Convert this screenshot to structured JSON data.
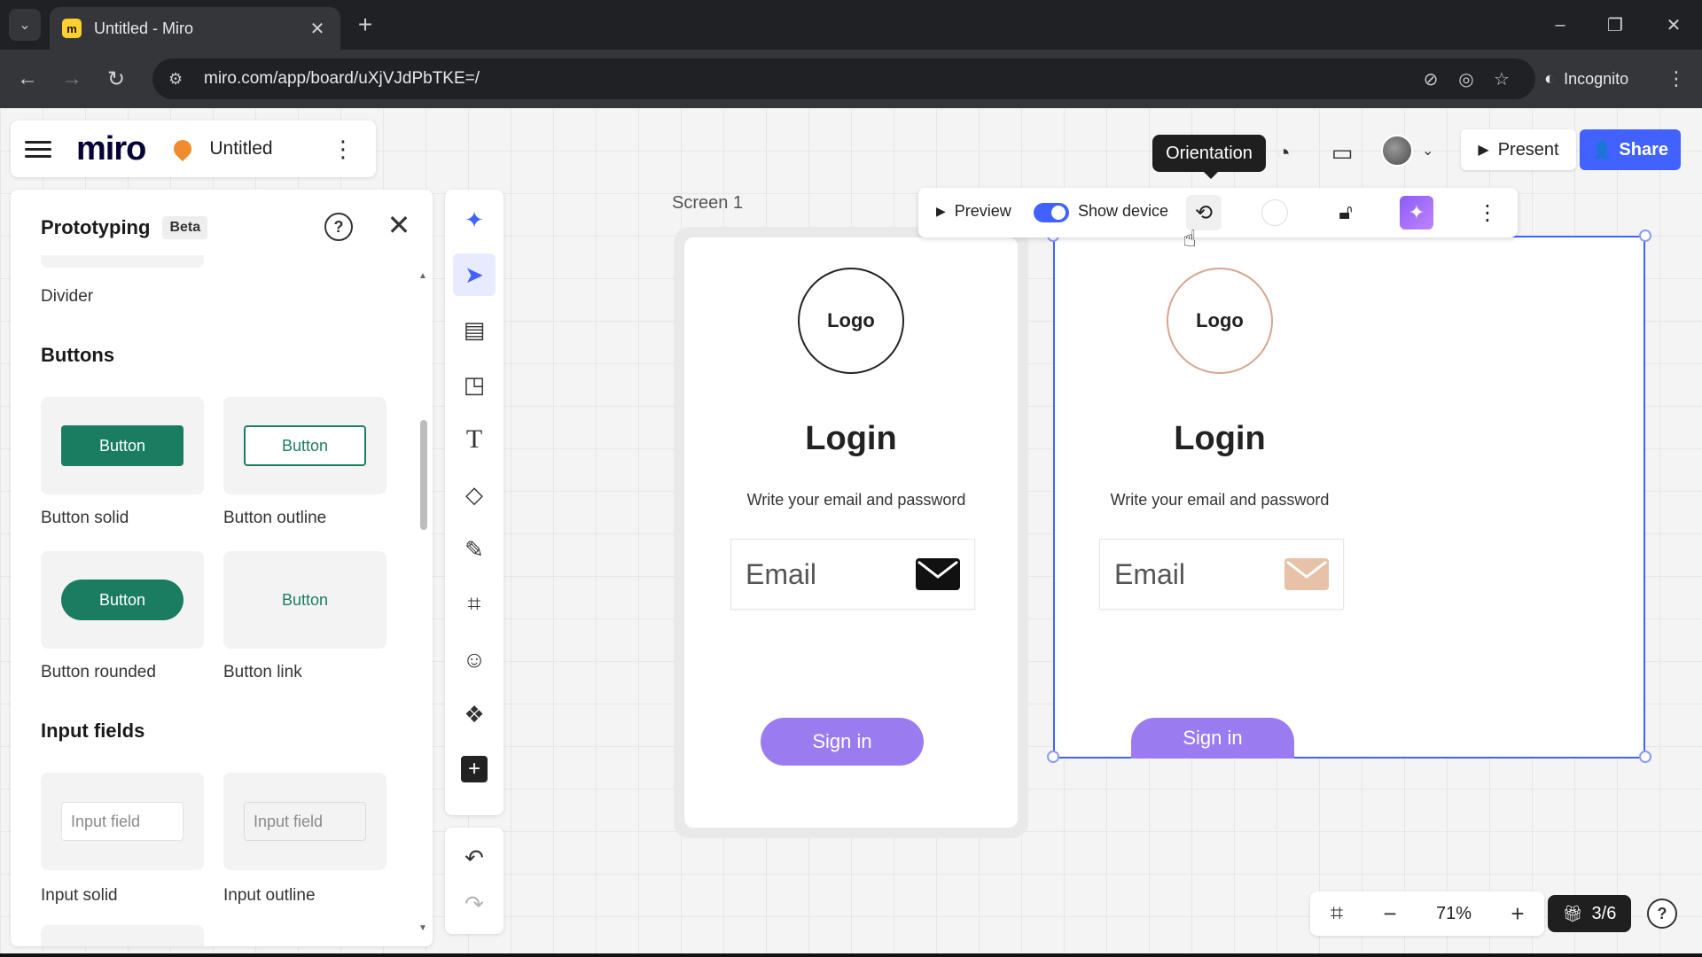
{
  "browser": {
    "tab_title": "Untitled - Miro",
    "tab_close": "✕",
    "new_tab": "+",
    "url": "miro.com/app/board/uXjVJdPbTKE=/",
    "incognito_label": "Incognito",
    "window_controls": [
      "–",
      "❐",
      "✕"
    ],
    "favicon_letter": "m"
  },
  "app": {
    "logo": "miro",
    "board_name": "Untitled"
  },
  "topbar": {
    "tooltip": "Orientation",
    "present_label": "Present",
    "share_label": "Share"
  },
  "panel": {
    "title": "Prototyping",
    "badge": "Beta",
    "divider_label": "Divider",
    "buttons_heading": "Buttons",
    "inputs_heading": "Input fields",
    "items": [
      {
        "preview": "Button",
        "label": "Button solid"
      },
      {
        "preview": "Button",
        "label": "Button outline"
      },
      {
        "preview": "Button",
        "label": "Button rounded"
      },
      {
        "preview": "Button",
        "label": "Button link"
      },
      {
        "preview": "Input field",
        "label": "Input solid"
      },
      {
        "preview": "Input field",
        "label": "Input outline"
      }
    ]
  },
  "canvas": {
    "frame_label": "Screen 1",
    "logo_text": "Logo",
    "login_title": "Login",
    "login_subtitle": "Write your email and password",
    "email_placeholder": "Email",
    "signin_label": "Sign in"
  },
  "frame_toolbar": {
    "preview_label": "Preview",
    "show_device_label": "Show device",
    "show_device_on": true
  },
  "zoom": {
    "level": "71%",
    "pager": "3/6"
  },
  "colors": {
    "accent": "#4262ff",
    "button_green": "#1a7d62",
    "signin_purple": "#9b7cf0"
  }
}
